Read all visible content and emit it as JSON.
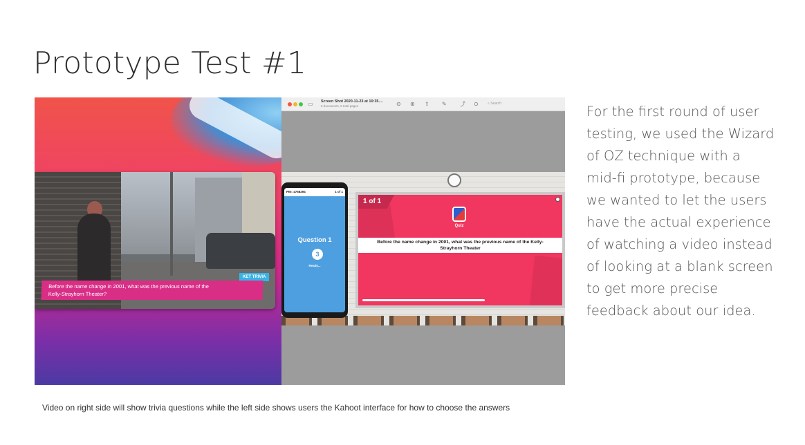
{
  "page": {
    "title": "Prototype Test #1",
    "caption": "Video on right side will show trivia questions while the left side shows users the Kahoot interface for how to choose the answers",
    "description_lines": [
      "For the first round of user",
      "testing, we used the Wizard",
      "of OZ technique with a",
      "mid-fi prototype, because",
      "we wanted to let the users",
      "have the actual experience",
      "of watching a video instead",
      "of looking at a blank screen",
      "to get more precise",
      "feedback about our idea."
    ]
  },
  "video": {
    "trivia_tag": "KET TRIVIA",
    "question_line1": "Before the name change in 2001, what was the previous name of the",
    "question_line2": "Kelly-Strayhorn Theater?"
  },
  "viewer": {
    "window_title": "Screen Shot 2020-11-23 at 10:35....",
    "window_subtitle": "5 documents, 5 total pages",
    "search_placeholder": "Search"
  },
  "phone": {
    "pin": "PIN: 4758294",
    "count": "1 of 1",
    "question_label": "Question 1",
    "timer": "3",
    "status": "Ready..."
  },
  "board": {
    "count": "1 of 1",
    "quiz_label": "Quiz",
    "question_line1": "Before the name change in 2001, what was the previous name of the Kelly-",
    "question_line2": "Strayhorn Theater",
    "progress": 0.6
  },
  "colors": {
    "kahoot_pink": "#f1365f",
    "phone_blue": "#4e9fe0",
    "banner_magenta": "#d92e86"
  }
}
